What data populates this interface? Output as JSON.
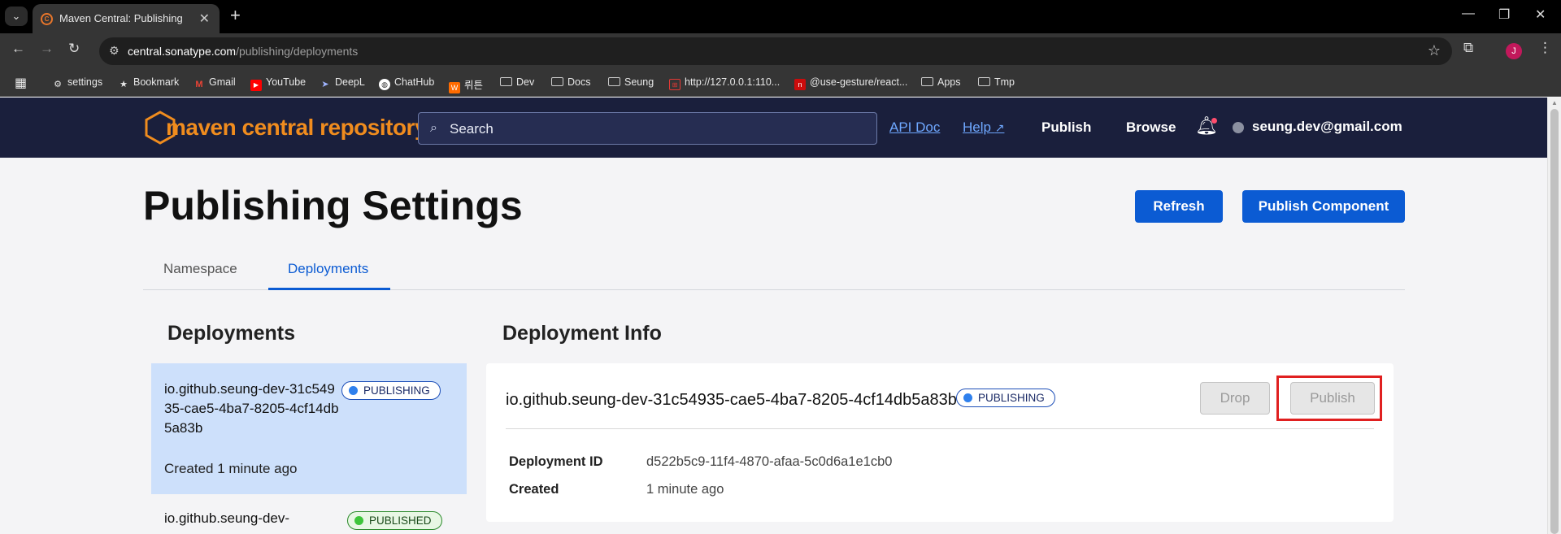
{
  "browser": {
    "tab_title": "Maven Central: Publishing",
    "url_host": "central.sonatype.com",
    "url_path": "/publishing/deployments",
    "profile_initial": "J",
    "bookmarks": [
      "settings",
      "Bookmark",
      "Gmail",
      "YouTube",
      "DeepL",
      "ChatHub",
      "뤼튼",
      "Dev",
      "Docs",
      "Seung",
      "http://127.0.0.1:110...",
      "@use-gesture/react...",
      "Apps",
      "Tmp"
    ]
  },
  "header": {
    "logo_text": "maven central repository",
    "search_placeholder": "Search",
    "api_doc": "API Doc",
    "help": "Help",
    "publish": "Publish",
    "browse": "Browse",
    "user_email": "seung.dev@gmail.com"
  },
  "page": {
    "title": "Publishing Settings",
    "refresh_label": "Refresh",
    "publish_component_label": "Publish Component",
    "tabs": [
      "Namespace",
      "Deployments"
    ],
    "active_tab": "Deployments"
  },
  "deployments": {
    "heading": "Deployments",
    "items": [
      {
        "name": "io.github.seung-dev-31c54935-cae5-4ba7-8205-4cf14db5a83b",
        "status": "PUBLISHING",
        "created": "Created 1 minute ago"
      },
      {
        "name": "io.github.seung-dev-",
        "status": "PUBLISHED",
        "created": ""
      }
    ]
  },
  "info": {
    "heading": "Deployment Info",
    "name": "io.github.seung-dev-31c54935-cae5-4ba7-8205-4cf14db5a83b",
    "status": "PUBLISHING",
    "drop_label": "Drop",
    "publish_label": "Publish",
    "fields": [
      {
        "label": "Deployment ID",
        "value": "d522b5c9-11f4-4870-afaa-5c0d6a1e1cb0"
      },
      {
        "label": "Created",
        "value": "1 minute ago"
      }
    ]
  },
  "colors": {
    "header_bg": "#1a1f3c",
    "brand_orange": "#f08c1e",
    "primary_blue": "#0b5bd3",
    "selected_row": "#cde0fb",
    "highlight_red": "#e02020"
  }
}
